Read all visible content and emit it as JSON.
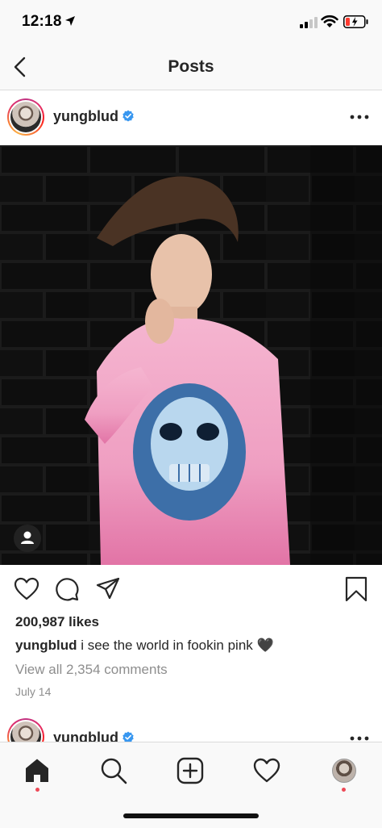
{
  "status_bar": {
    "time": "12:18"
  },
  "nav": {
    "title": "Posts"
  },
  "post": {
    "username": "yungblud",
    "likes": "200,987 likes",
    "caption_user": "yungblud",
    "caption_text": " i see the world in fookin pink 🖤",
    "comments_link": "View all 2,354 comments",
    "date": "July 14"
  },
  "next_post": {
    "username": "yungblud"
  },
  "colors": {
    "notification_dot": "#ed4956",
    "verified": "#3897f0"
  }
}
